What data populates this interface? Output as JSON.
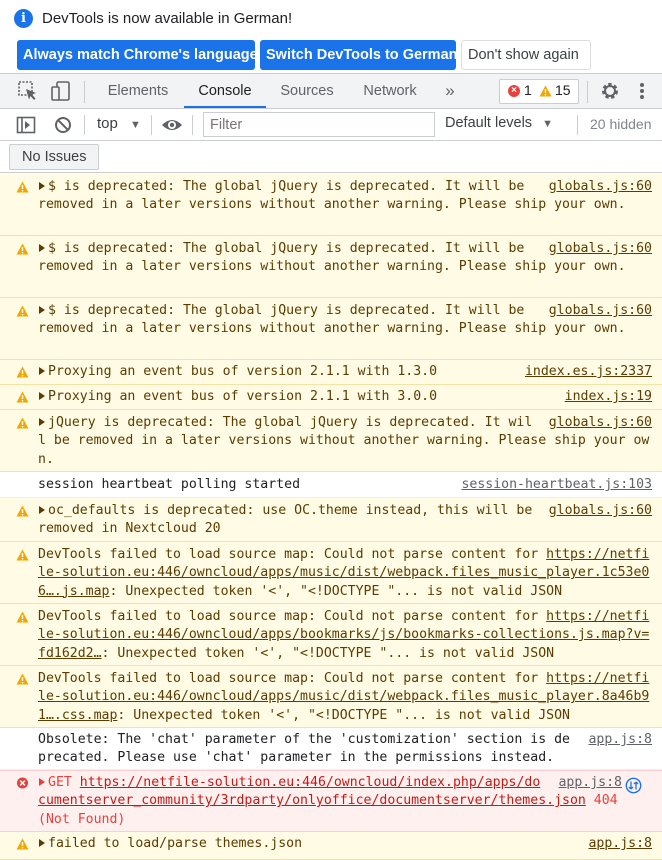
{
  "infobar": {
    "message": "DevTools is now available in German!",
    "btn_match": "Always match Chrome's language",
    "btn_switch": "Switch DevTools to German",
    "btn_dismiss": "Don't show again"
  },
  "tabs": {
    "elements": "Elements",
    "console": "Console",
    "sources": "Sources",
    "network": "Network",
    "more": "»",
    "errors_count": "1",
    "warnings_count": "15"
  },
  "toolbar": {
    "context": "top",
    "filter_placeholder": "Filter",
    "levels": "Default levels",
    "hidden": "20 hidden"
  },
  "issues": {
    "label": "No Issues"
  },
  "messages": [
    {
      "level": "warning",
      "text": "$ is deprecated: The global jQuery is deprecated. It will be removed in a later versions without another warning. Please ship your own.",
      "source": "globals.js:60"
    },
    {
      "level": "warning",
      "text": "$ is deprecated: The global jQuery is deprecated. It will be removed in a later versions without another warning. Please ship your own.",
      "source": "globals.js:60"
    },
    {
      "level": "warning",
      "text": "$ is deprecated: The global jQuery is deprecated. It will be removed in a later versions without another warning. Please ship your own.",
      "source": "globals.js:60"
    },
    {
      "level": "warning",
      "text": "Proxying an event bus of version 2.1.1 with 1.3.0",
      "source": "index.es.js:2337"
    },
    {
      "level": "warning",
      "text": "Proxying an event bus of version 2.1.1 with 3.0.0",
      "source": "index.js:19"
    },
    {
      "level": "warning",
      "text": "jQuery is deprecated: The global jQuery is deprecated. It will be removed in a later versions without another warning. Please ship your own.",
      "source": "globals.js:60"
    },
    {
      "level": "info",
      "text": "session heartbeat polling started",
      "source": "session-heartbeat.js:103"
    },
    {
      "level": "warning",
      "text": "oc_defaults is deprecated: use OC.theme instead, this will be removed in Nextcloud 20",
      "source": "globals.js:60"
    },
    {
      "level": "warning",
      "prefix": "DevTools failed to load source map: Could not parse content for ",
      "url": "https://netfile-solution.eu:446/owncloud/apps/music/dist/webpack.files_music_player.1c53e06….js.map",
      "suffix": ": Unexpected token '<', \"<!DOCTYPE \"... is not valid JSON"
    },
    {
      "level": "warning",
      "prefix": "DevTools failed to load source map: Could not parse content for ",
      "url": "https://netfile-solution.eu:446/owncloud/apps/bookmarks/js/bookmarks-collections.js.map?v=fd162d2…",
      "suffix": ": Unexpected token '<', \"<!DOCTYPE \"... is not valid JSON"
    },
    {
      "level": "warning",
      "prefix": "DevTools failed to load source map: Could not parse content for ",
      "url": "https://netfile-solution.eu:446/owncloud/apps/music/dist/webpack.files_music_player.8a46b91….css.map",
      "suffix": ": Unexpected token '<', \"<!DOCTYPE \"... is not valid JSON"
    },
    {
      "level": "info",
      "text": "Obsolete: The 'chat' parameter of the 'customization' section is deprecated. Please use 'chat' parameter in the permissions instead.",
      "source": "app.js:8"
    },
    {
      "level": "error",
      "method": "GET",
      "url": "https://netfile-solution.eu:446/owncloud/index.php/apps/documentserver_community/3rdparty/onlyoffice/documentserver/themes.json",
      "status": "404 (Not Found)",
      "source": "app.js:8"
    },
    {
      "level": "warning",
      "text": "failed to load/parse themes.json",
      "source": "app.js:8"
    }
  ],
  "colors": {
    "accent": "#1a73e8",
    "warning_bg": "#fffbe5",
    "warning_text": "#5c3c00",
    "error_bg": "#fff0f0",
    "error_text": "#e8413d"
  }
}
